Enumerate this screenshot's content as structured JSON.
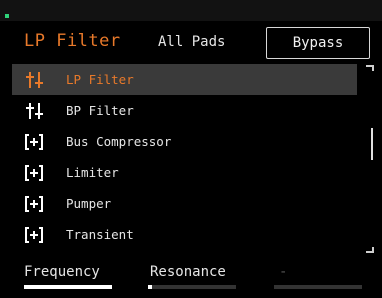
{
  "header": {
    "title": "LP Filter",
    "scope": "All Pads",
    "bypass_label": "Bypass"
  },
  "effects": [
    {
      "label": "LP Filter",
      "icon": "filter-icon",
      "selected": true
    },
    {
      "label": "BP Filter",
      "icon": "filter-icon",
      "selected": false
    },
    {
      "label": "Bus Compressor",
      "icon": "dynamics-icon",
      "selected": false
    },
    {
      "label": "Limiter",
      "icon": "dynamics-icon",
      "selected": false
    },
    {
      "label": "Pumper",
      "icon": "dynamics-icon",
      "selected": false
    },
    {
      "label": "Transient",
      "icon": "dynamics-icon",
      "selected": false
    }
  ],
  "params": [
    {
      "label": "Frequency",
      "fill": 1.0
    },
    {
      "label": "Resonance",
      "fill": 0.05
    },
    {
      "label": "-",
      "fill": 0.0
    }
  ],
  "colors": {
    "accent": "#e8792a",
    "selected_row": "#3a3a3a",
    "indicator": "#2fd37a"
  }
}
